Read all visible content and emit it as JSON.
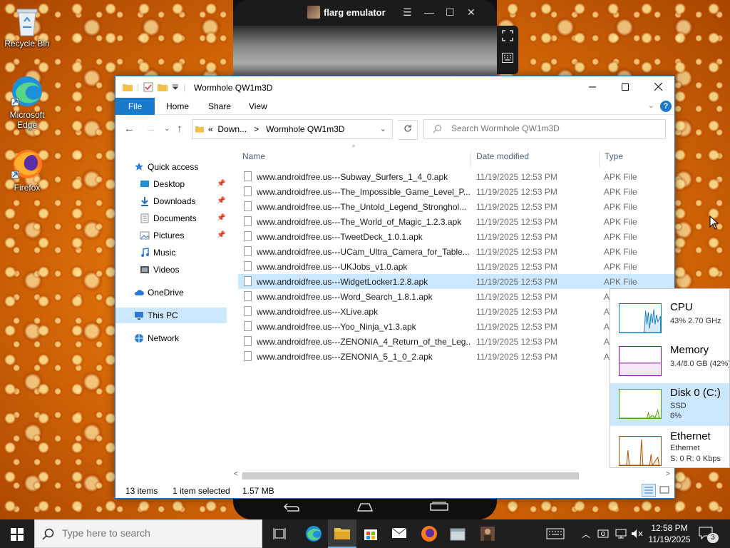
{
  "desktop": {
    "icons": [
      {
        "label": "Recycle Bin"
      },
      {
        "label": "Microsoft Edge"
      },
      {
        "label": "Firefox"
      }
    ]
  },
  "emulator": {
    "title": "flarg emulator",
    "controls": {
      "menu": "☰",
      "minimize": "—",
      "maximize": "☐",
      "close": "✕"
    }
  },
  "explorer": {
    "title": "Wormhole QW1m3D",
    "ribbon_tabs": [
      "File",
      "Home",
      "Share",
      "View"
    ],
    "help": "?",
    "address": {
      "overflow": "«",
      "parent": "Down...",
      "separator": ">",
      "current": "Wormhole QW1m3D"
    },
    "search_placeholder": "Search Wormhole QW1m3D",
    "nav": {
      "quick_access": "Quick access",
      "items": [
        {
          "label": "Desktop",
          "pinned": true
        },
        {
          "label": "Downloads",
          "pinned": true
        },
        {
          "label": "Documents",
          "pinned": true
        },
        {
          "label": "Pictures",
          "pinned": true
        },
        {
          "label": "Music",
          "pinned": false
        },
        {
          "label": "Videos",
          "pinned": false
        }
      ],
      "onedrive": "OneDrive",
      "this_pc": "This PC",
      "network": "Network"
    },
    "columns": {
      "name": "Name",
      "date": "Date modified",
      "type": "Type"
    },
    "files": [
      {
        "name": "www.androidfree.us---Subway_Surfers_1_4_0.apk",
        "date": "11/19/2025 12:53 PM",
        "type": "APK File"
      },
      {
        "name": "www.androidfree.us---The_Impossible_Game_Level_P...",
        "date": "11/19/2025 12:53 PM",
        "type": "APK File"
      },
      {
        "name": "www.androidfree.us---The_Untold_Legend_Stronghol...",
        "date": "11/19/2025 12:53 PM",
        "type": "APK File"
      },
      {
        "name": "www.androidfree.us---The_World_of_Magic_1.2.3.apk",
        "date": "11/19/2025 12:53 PM",
        "type": "APK File"
      },
      {
        "name": "www.androidfree.us---TweetDeck_1.0.1.apk",
        "date": "11/19/2025 12:53 PM",
        "type": "APK File"
      },
      {
        "name": "www.androidfree.us---UCam_Ultra_Camera_for_Table...",
        "date": "11/19/2025 12:53 PM",
        "type": "APK File"
      },
      {
        "name": "www.androidfree.us---UKJobs_v1.0.apk",
        "date": "11/19/2025 12:53 PM",
        "type": "APK File"
      },
      {
        "name": "www.androidfree.us---WidgetLocker1.2.8.apk",
        "date": "11/19/2025 12:53 PM",
        "type": "APK File"
      },
      {
        "name": "www.androidfree.us---Word_Search_1.8.1.apk",
        "date": "11/19/2025 12:53 PM",
        "type": "A"
      },
      {
        "name": "www.androidfree.us---XLive.apk",
        "date": "11/19/2025 12:53 PM",
        "type": "A"
      },
      {
        "name": "www.androidfree.us---Yoo_Ninja_v1.3.apk",
        "date": "11/19/2025 12:53 PM",
        "type": "A"
      },
      {
        "name": "www.androidfree.us---ZENONIA_4_Return_of_the_Leg...",
        "date": "11/19/2025 12:53 PM",
        "type": "A"
      },
      {
        "name": "www.androidfree.us---ZENONIA_5_1_0_2.apk",
        "date": "11/19/2025 12:53 PM",
        "type": "A"
      }
    ],
    "selected_index": 7,
    "status": {
      "items": "13 items",
      "selected": "1 item selected",
      "size": "1.57 MB"
    }
  },
  "perf_panel": {
    "cpu": {
      "name": "CPU",
      "detail": "43% 2.70 GHz",
      "color": "#117dbb"
    },
    "memory": {
      "name": "Memory",
      "detail": "3.4/8.0 GB (42%)",
      "color": "#8b12ae"
    },
    "disk": {
      "name": "Disk 0 (C:)",
      "detail1": "SSD",
      "detail2": "6%",
      "color": "#4da60c"
    },
    "ethernet": {
      "name": "Ethernet",
      "detail1": "Ethernet",
      "detail2": "S: 0 R: 0 Kbps",
      "color": "#a74f01"
    }
  },
  "taskbar": {
    "search_placeholder": "Type here to search",
    "time": "12:58 PM",
    "date": "11/19/2025",
    "notifications": "3"
  }
}
